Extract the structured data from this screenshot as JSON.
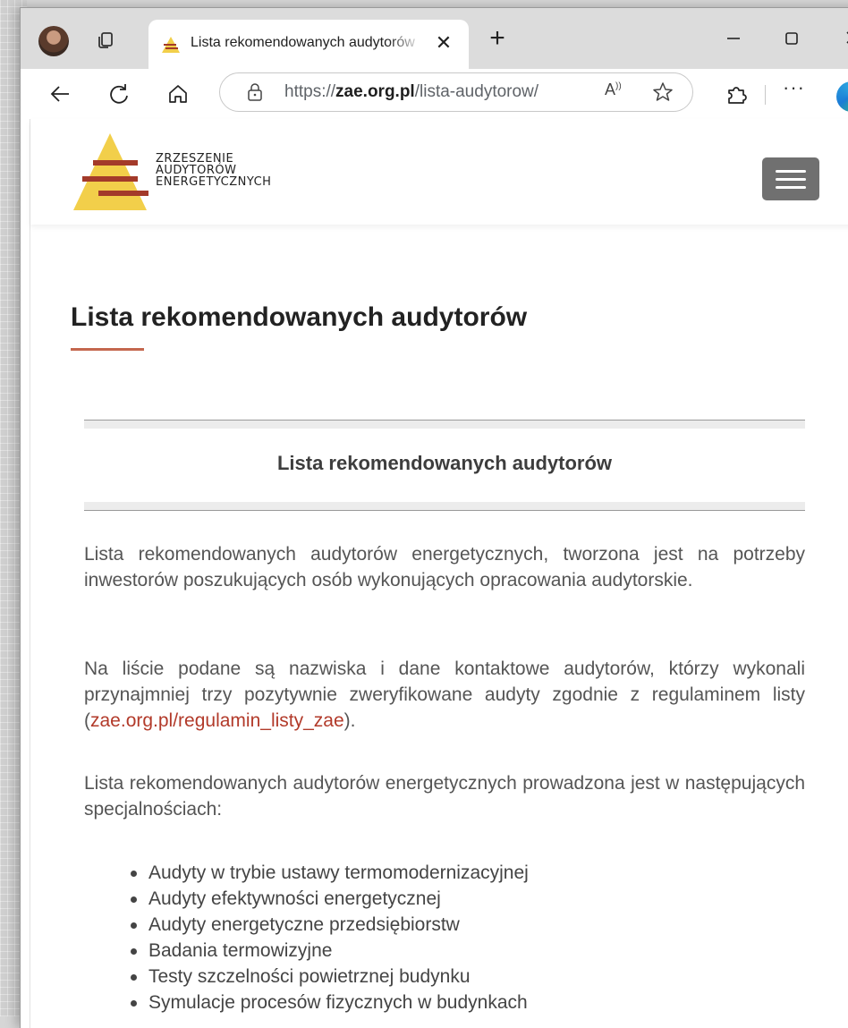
{
  "browser": {
    "tab_title": "Lista rekomendowanych audytorów",
    "url_prefix": "https://",
    "url_domain": "zae.org.pl",
    "url_path": "/lista-audytorow/",
    "tab_close_glyph": "✕",
    "new_tab_glyph": "+",
    "read_aloud_glyph": "À",
    "more_glyph": "···"
  },
  "site": {
    "logo_lines": [
      "ZRZESZENIE",
      "AUDYTORÓW",
      "ENERGETYCZNYCH"
    ],
    "logo_colors": {
      "triangle": "#f2cf4a",
      "bars": "#a33a2a"
    }
  },
  "main": {
    "page_title": "Lista rekomendowanych audytorów",
    "section_heading": "Lista rekomendowanych audytorów",
    "para1": "Lista rekomendowanych audytorów energetycznych, tworzona jest na potrzeby inwestorów poszukujących osób wykonujących opracowania audytorskie.",
    "para2_before": "Na liście podane są nazwiska i dane kontaktowe audytorów, którzy wykonali przynajmniej trzy pozytywnie zweryfikowane audyty zgodnie z regulaminem listy (",
    "para2_link": "zae.org.pl/regulamin_listy_zae",
    "para2_after": ").",
    "para3": "Lista rekomendowanych audytorów energetycznych prowadzona jest w następujących specjalnościach:",
    "specialties": [
      "Audyty w trybie ustawy termomodernizacyjnej",
      "Audyty efektywności energetycznej",
      "Audyty energetyczne przedsiębiorstw",
      "Badania termowizyjne",
      "Testy szczelności powietrznej budynku",
      "Symulacje procesów fizycznych w budynkach"
    ]
  },
  "colors": {
    "accent_underline": "#c4674e",
    "link": "#b23a2a"
  },
  "icons": {
    "profile": "avatar",
    "tabs": "tab-actions-icon",
    "back": "back-arrow-icon",
    "refresh": "refresh-icon",
    "home": "home-icon",
    "lock": "lock-icon",
    "favorite": "star-icon",
    "extensions": "puzzle-icon",
    "more": "more-icon",
    "edge": "edge-icon"
  }
}
